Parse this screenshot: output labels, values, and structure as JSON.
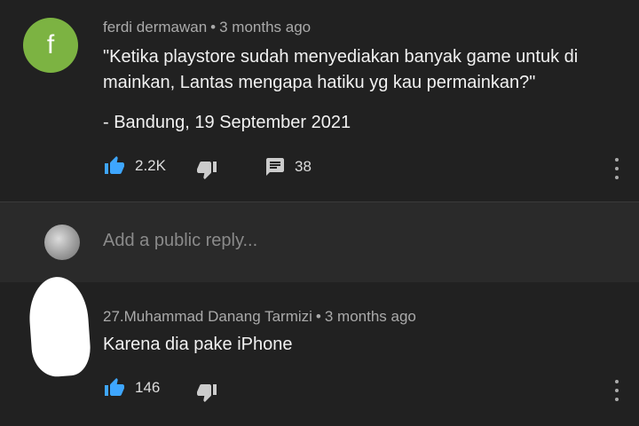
{
  "comment": {
    "avatar_letter": "f",
    "author": "ferdi dermawan",
    "separator": "•",
    "time": "3 months ago",
    "text_line1": "\"Ketika playstore sudah menyediakan banyak game untuk di",
    "text_line2": "mainkan, Lantas mengapa hatiku yg kau permainkan?\"",
    "text_line3": "- Bandung, 19 September 2021",
    "likes": "2.2K",
    "replies": "38"
  },
  "reply_bar": {
    "placeholder": "Add a public reply..."
  },
  "reply": {
    "author": "27.Muhammad Danang Tarmizi",
    "separator": "•",
    "time": "3 months ago",
    "text": "Karena dia pake iPhone",
    "likes": "146"
  },
  "colors": {
    "background": "#212121",
    "reply_bar_background": "#2a2a2a",
    "like_icon": "#3ea6ff",
    "avatar_green": "#7cb342"
  },
  "icons": [
    "like-icon",
    "dislike-icon",
    "comment-icon",
    "more-vert-icon"
  ]
}
